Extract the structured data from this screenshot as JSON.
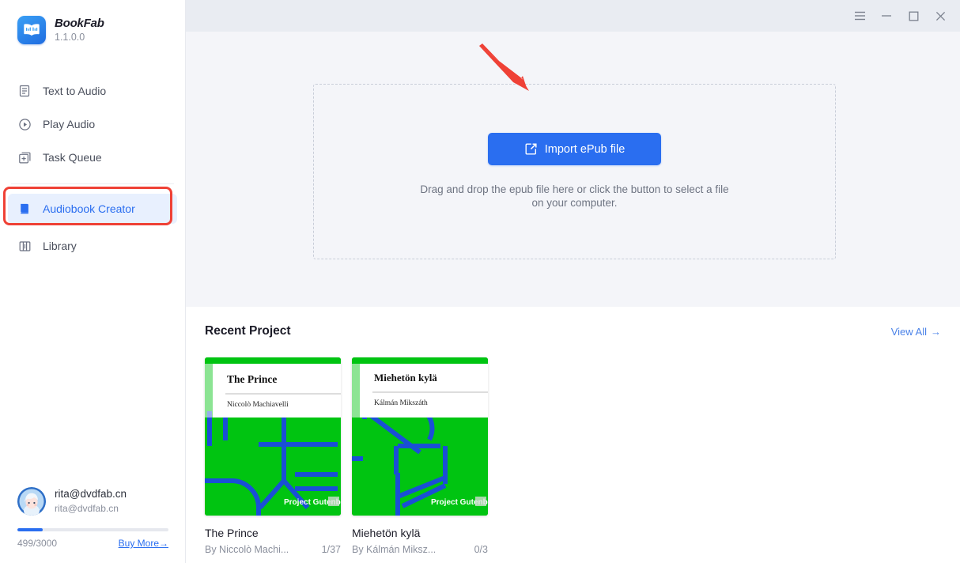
{
  "brand": {
    "name": "BookFab",
    "version": "1.1.0.0",
    "logo_icon": "book-icon"
  },
  "sidebar": {
    "items": [
      {
        "label": "Text to Audio",
        "icon": "document-icon",
        "active": false
      },
      {
        "label": "Play Audio",
        "icon": "play-circle-icon",
        "active": false
      },
      {
        "label": "Task Queue",
        "icon": "task-queue-icon",
        "active": false
      },
      {
        "label": "Audiobook Creator",
        "icon": "book-filled-icon",
        "active": true
      },
      {
        "label": "Library",
        "icon": "bookshelf-icon",
        "active": false
      }
    ]
  },
  "user": {
    "name": "rita@dvdfab.cn",
    "email": "rita@dvdfab.cn",
    "avatar_icon": "user-avatar",
    "quota_used": 499,
    "quota_total": 3000,
    "quota_label": "499/3000",
    "quota_percent": 16.6,
    "buy_more_label": "Buy More",
    "buy_more_arrow": "→"
  },
  "titlebar": {
    "menu_icon": "hamburger-menu-icon",
    "minimize_icon": "minimize-icon",
    "maximize_icon": "maximize-icon",
    "close_icon": "close-icon"
  },
  "dropzone": {
    "button_label": "Import ePub file",
    "button_icon": "import-file-icon",
    "hint_line1": "Drag and drop the epub file here or click the button to select a file",
    "hint_line2": "on your computer."
  },
  "annotations": {
    "arrow_color": "#ef4136",
    "box_color": "#ef4136",
    "box_target": "Audiobook Creator",
    "arrow_target": "Import ePub file"
  },
  "recent": {
    "title": "Recent Project",
    "view_all_label": "View All",
    "view_all_arrow": "→",
    "projects": [
      {
        "title": "The Prince",
        "author_line": "By Niccolò Machi...",
        "progress": "1/37",
        "cover": {
          "title": "The Prince",
          "author": "Niccolò Machiavelli",
          "publisher": "Project Gutenberg",
          "bg_color": "#00c411",
          "line_color": "#1a4fd6"
        }
      },
      {
        "title": "Miehetön kylä",
        "author_line": "By Kálmán Miksz...",
        "progress": "0/3",
        "cover": {
          "title": "Miehetön kylä",
          "author": "Kálmán Mikszáth",
          "publisher": "Project Gutenberg",
          "bg_color": "#00c411",
          "line_color": "#1a4fd6"
        }
      }
    ]
  },
  "colors": {
    "accent": "#2a6ef0",
    "titlebar_bg": "#e9ecf2",
    "content_bg": "#f4f5f9",
    "active_nav_bg": "#e8f0fe",
    "annotation_red": "#ef4136"
  }
}
